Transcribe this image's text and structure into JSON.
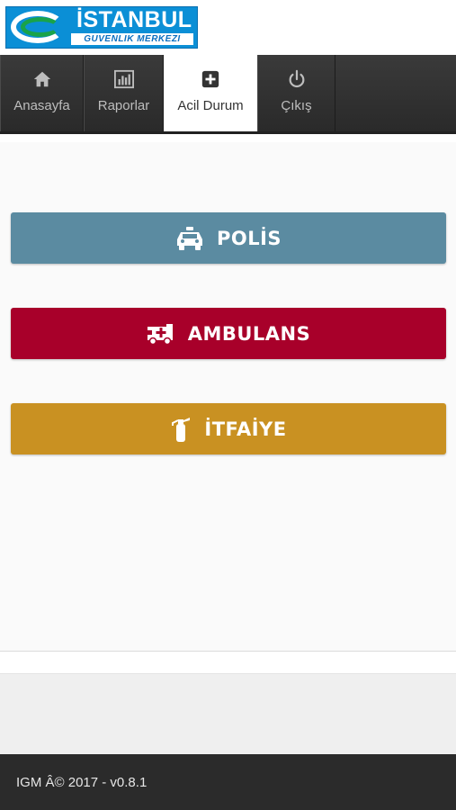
{
  "logo": {
    "title": "İSTANBUL",
    "subtitle": "GUVENLIK MERKEZI"
  },
  "nav": {
    "items": [
      {
        "label": "Anasayfa",
        "icon": "home-icon"
      },
      {
        "label": "Raporlar",
        "icon": "bar-chart-icon"
      },
      {
        "label": "Acil Durum",
        "icon": "plus-square-icon",
        "active": true
      },
      {
        "label": "Çıkış",
        "icon": "power-icon"
      }
    ]
  },
  "buttons": {
    "police": {
      "label": "POLİS",
      "icon": "police-car-icon",
      "color": "#5b8ba1"
    },
    "ambulance": {
      "label": "AMBULANS",
      "icon": "ambulance-icon",
      "color": "#a8002a"
    },
    "fire": {
      "label": "İTFAİYE",
      "icon": "fire-extinguisher-icon",
      "color": "#c99122"
    }
  },
  "footer": {
    "text": "IGM Â© 2017 - v0.8.1"
  }
}
